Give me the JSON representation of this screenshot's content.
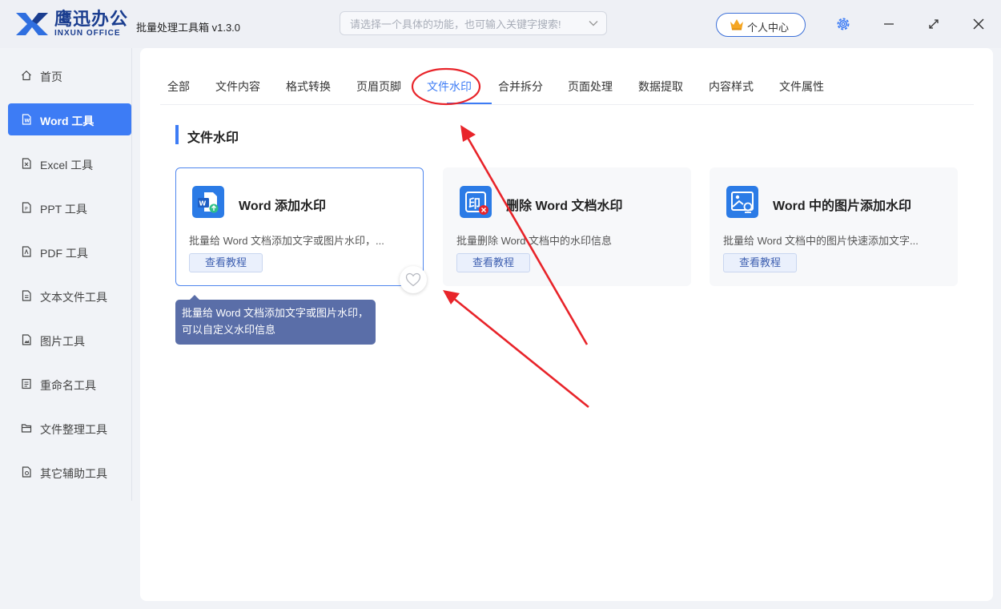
{
  "brand": {
    "name_cn": "鹰迅办公",
    "name_en": "INXUN OFFICE",
    "color": "#1a3d8f"
  },
  "app": {
    "title": "批量处理工具箱 v1.3.0"
  },
  "search": {
    "placeholder": "请选择一个具体的功能，也可输入关键字搜索!",
    "value": ""
  },
  "header": {
    "user_center_label": "个人中心",
    "icons": [
      "settings-icon",
      "minimize-icon",
      "restore-icon",
      "close-icon"
    ]
  },
  "sidebar": {
    "items": [
      {
        "label": "首页",
        "icon": "home-icon"
      },
      {
        "label": "Word 工具",
        "icon": "word-file-icon",
        "active": true
      },
      {
        "label": "Excel 工具",
        "icon": "excel-file-icon"
      },
      {
        "label": "PPT 工具",
        "icon": "ppt-file-icon"
      },
      {
        "label": "PDF 工具",
        "icon": "pdf-file-icon"
      },
      {
        "label": "文本文件工具",
        "icon": "text-file-icon"
      },
      {
        "label": "图片工具",
        "icon": "image-file-icon"
      },
      {
        "label": "重命名工具",
        "icon": "rename-icon"
      },
      {
        "label": "文件整理工具",
        "icon": "folder-icon"
      },
      {
        "label": "其它辅助工具",
        "icon": "misc-tool-icon"
      }
    ]
  },
  "tabs": [
    {
      "label": "全部"
    },
    {
      "label": "文件内容"
    },
    {
      "label": "格式转换"
    },
    {
      "label": "页眉页脚"
    },
    {
      "label": "文件水印",
      "active": true
    },
    {
      "label": "合并拆分"
    },
    {
      "label": "页面处理"
    },
    {
      "label": "数据提取"
    },
    {
      "label": "内容样式"
    },
    {
      "label": "文件属性"
    }
  ],
  "section": {
    "title": "文件水印"
  },
  "cards": [
    {
      "title": "Word 添加水印",
      "desc": "批量给 Word 文档添加文字或图片水印，...",
      "tutorial_label": "查看教程",
      "icon": "word-watermark-add-icon",
      "active": true
    },
    {
      "title": "删除 Word 文档水印",
      "desc": "批量删除 Word 文档中的水印信息",
      "tutorial_label": "查看教程",
      "icon": "watermark-remove-icon"
    },
    {
      "title": "Word 中的图片添加水印",
      "desc": "批量给 Word 文档中的图片快速添加文字...",
      "tutorial_label": "查看教程",
      "icon": "image-watermark-icon"
    }
  ],
  "tooltip": {
    "text": "批量给 Word 文档添加文字或图片水印，可以自定义水印信息"
  },
  "colors": {
    "accent": "#3d7cf5",
    "annotation": "#e8242a",
    "tooltip_bg": "#5a6ea8"
  }
}
